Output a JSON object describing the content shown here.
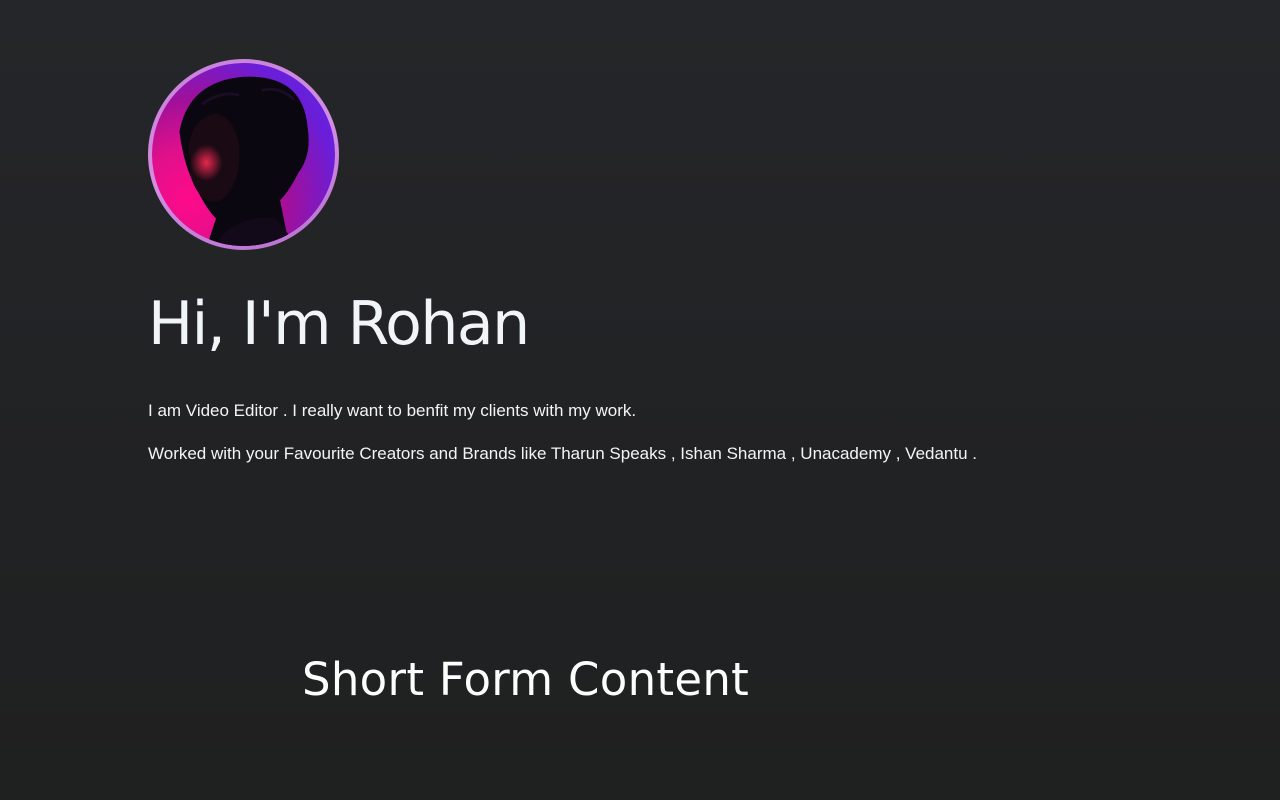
{
  "hero": {
    "avatar_alt": "Profile photo",
    "title": "Hi, I'm Rohan",
    "bio_line_1": "I am Video Editor . I really want to benfit my clients with my work.",
    "bio_line_2": "Worked with your Favourite Creators and Brands like Tharun Speaks , Ishan Sharma , Unacademy , Vedantu ."
  },
  "sections": {
    "short_form_title": "Short Form Content"
  },
  "colors": {
    "background": "#232426",
    "avatar_ring": "#cc88dd",
    "avatar_glow_pink": "#ff0a8a",
    "avatar_glow_purple": "#5b2af0",
    "text": "#ffffff"
  }
}
